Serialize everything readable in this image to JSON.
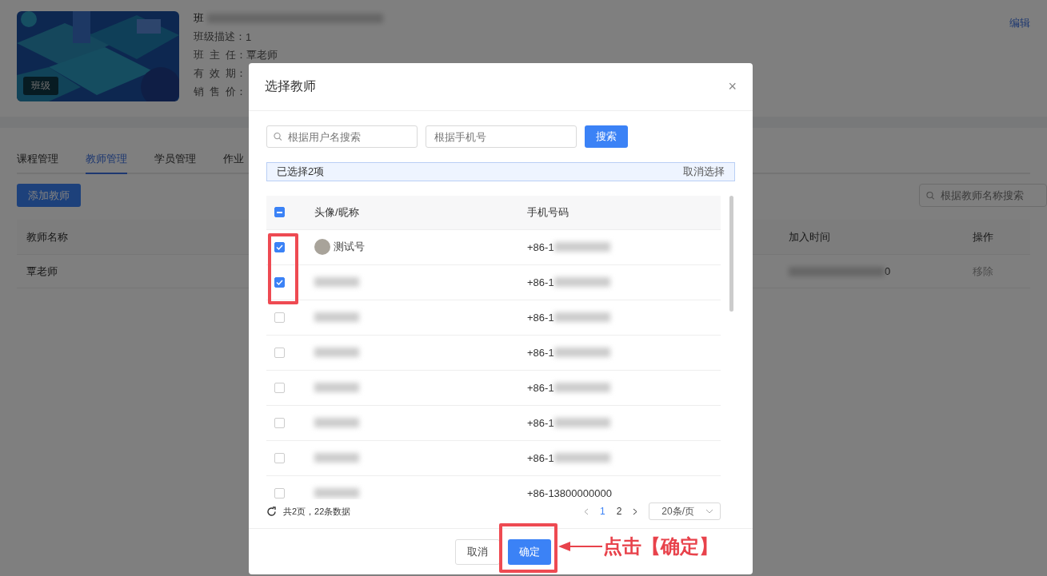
{
  "course": {
    "badge": "班级",
    "title": "班",
    "edit": "编辑",
    "fields": [
      {
        "label": "班级描述：",
        "value": "1"
      },
      {
        "label": "班  主  任：",
        "value": "覃老师"
      },
      {
        "label": "有  效  期："
      },
      {
        "label": "销  售  价："
      }
    ]
  },
  "tabs": [
    {
      "label": "课程管理",
      "selected": false
    },
    {
      "label": "教师管理",
      "selected": true
    },
    {
      "label": "学员管理",
      "selected": false
    },
    {
      "label": "作业",
      "selected": false
    }
  ],
  "add_button": "添加教师",
  "teacher_search": {
    "placeholder": "根据教师名称搜索"
  },
  "teacher_table": {
    "columns": [
      "教师名称",
      "加入时间",
      "操作"
    ],
    "rows": [
      {
        "name": "覃老师",
        "time": "0",
        "action": "移除"
      }
    ]
  },
  "dialog": {
    "title": "选择教师",
    "close": "×",
    "user_search": {
      "placeholder": "根据用户名搜索"
    },
    "phone_search": {
      "placeholder": "根据手机号"
    },
    "search_button": "搜索",
    "selection": {
      "text": "已选择2项",
      "clear": "取消选择"
    },
    "select_all": {
      "indeterminate": true
    },
    "columns": [
      "头像/昵称",
      "手机号码"
    ],
    "rows": [
      {
        "name": "测试号",
        "phone": "+86-1",
        "checked": true
      },
      {
        "phone": "+86-1",
        "checked": true
      },
      {
        "phone": "+86-1",
        "checked": false
      },
      {
        "phone": "+86-1",
        "checked": false
      },
      {
        "phone": "+86-1",
        "checked": false
      },
      {
        "phone": "+86-1",
        "checked": false
      },
      {
        "phone": "+86-1",
        "checked": false
      },
      {
        "phone": "+86-13800000000",
        "checked": false
      }
    ],
    "summary": "共2页，22条数据",
    "pages": [
      {
        "label": "1",
        "selected": true
      },
      {
        "label": "2",
        "selected": false
      }
    ],
    "page_size": "20条/页",
    "cancel": "取消",
    "confirm": "确定"
  },
  "annotation": {
    "text": "点击【确定】"
  }
}
